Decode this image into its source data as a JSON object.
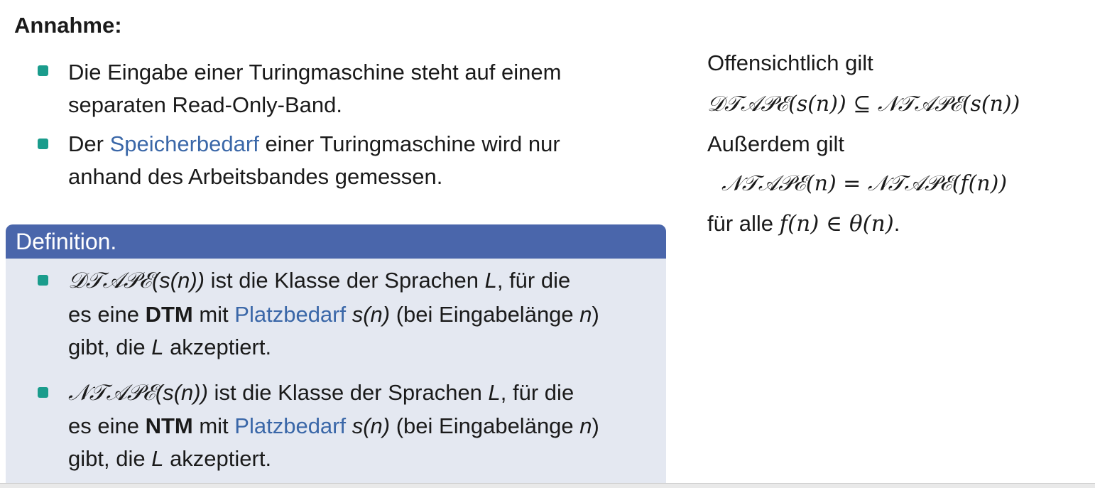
{
  "heading": "Annahme:",
  "colors": {
    "bullet": "#1a9c8c",
    "term_link": "#3a67a8",
    "definition_header": "#4a66ab",
    "definition_body": "#e4e8f1"
  },
  "assumption": {
    "item1": {
      "line1": "Die Eingabe einer Turingmaschine steht auf einem",
      "line2": "separaten Read-Only-Band."
    },
    "item2": {
      "prefix": "Der ",
      "term": "Speicherbedarf",
      "suffix": " einer Turingmaschine wird nur",
      "line2": "anhand des Arbeitsbandes gemessen."
    }
  },
  "definition": {
    "title": "Definition.",
    "item1": {
      "class_name": "𝒟𝒯𝒜𝒫ℰ",
      "arg": "(s(n))",
      "text1": " ist die Klasse der Sprachen ",
      "var_L": "L",
      "text2": ", für die",
      "line2_prefix": "es eine ",
      "machine": "DTM",
      "line2_mid": " mit ",
      "term": "Platzbedarf",
      "space_fn": " s(n)",
      "line2_tail": " (bei Eingabelänge ",
      "var_n": "n",
      "line2_end": ")",
      "line3_prefix": "gibt, die ",
      "line3_L": "L",
      "line3_suffix": " akzeptiert."
    },
    "item2": {
      "class_name": "𝒩𝒯𝒜𝒫ℰ",
      "arg": "(s(n))",
      "text1": " ist die Klasse der Sprachen ",
      "var_L": "L",
      "text2": ", für die",
      "line2_prefix": "es eine ",
      "machine": "NTM",
      "line2_mid": " mit ",
      "term": "Platzbedarf",
      "space_fn": " s(n)",
      "line2_tail": " (bei Eingabelänge ",
      "var_n": "n",
      "line2_end": ")",
      "line3_prefix": "gibt, die ",
      "line3_L": "L",
      "line3_suffix": " akzeptiert."
    }
  },
  "right": {
    "line1": "Offensichtlich gilt",
    "formula1": "𝒟𝒯𝒜𝒫ℰ(s(n)) ⊆ 𝒩𝒯𝒜𝒫ℰ(s(n))",
    "line3": "Außerdem gilt",
    "formula2": "𝒩𝒯𝒜𝒫ℰ(n) = 𝒩𝒯𝒜𝒫ℰ(f(n))",
    "line5_prefix": "für alle ",
    "line5_formula": "f(n) ∈ θ(n)",
    "line5_suffix": "."
  }
}
